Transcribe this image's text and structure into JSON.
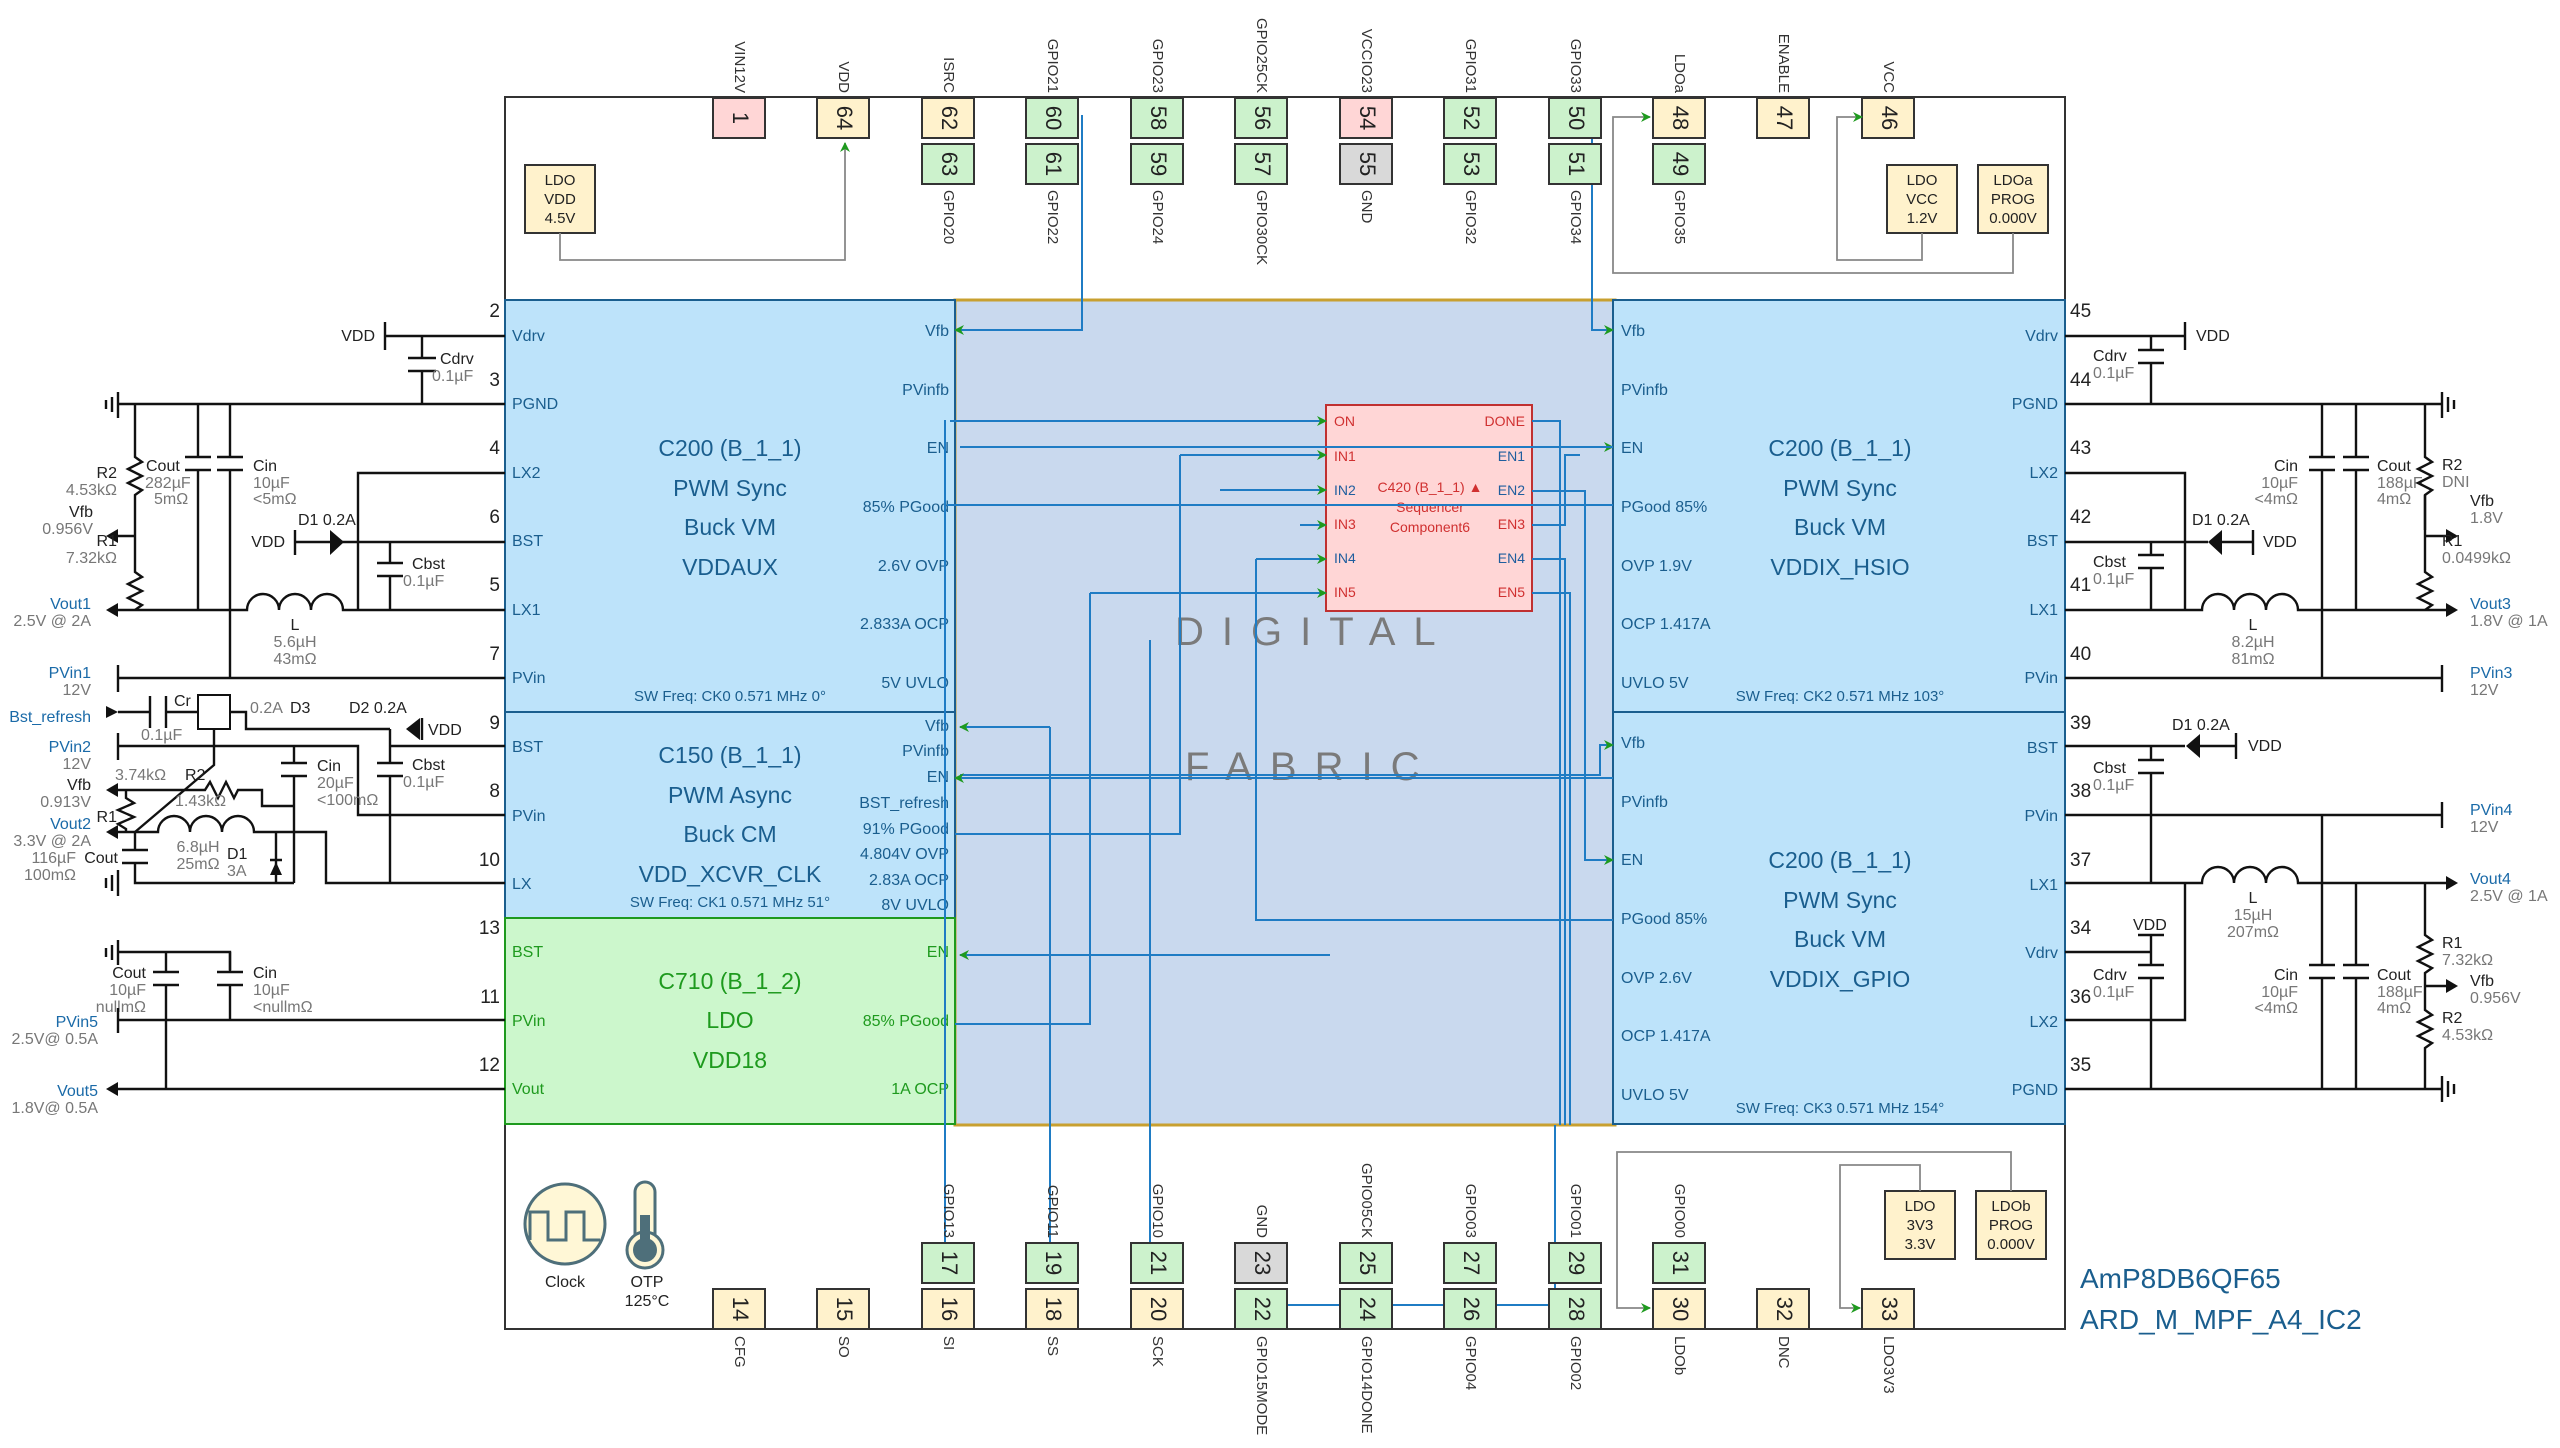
{
  "title": {
    "part": "AmP8DB6QF65",
    "design": "ARD_M_MPF_A4_IC2"
  },
  "colors": {
    "buck_fill": "#bde3fa",
    "ldo_fill": "#ccf7cc",
    "fabric_fill": "#c9d9ee",
    "sequencer_fill": "#ffd6d6",
    "pin_power": "#fff2cc",
    "pin_gpio": "#ccf2cc",
    "pin_red": "#ffd6d6",
    "pin_gnd": "#d9d9d9",
    "signal_wire": "#1f7cc4",
    "arrow": "#1e9a1e"
  },
  "top_pins": [
    {
      "num": "1",
      "label": "VIN12V",
      "type": "red"
    },
    {
      "num": "64",
      "label": "VDD",
      "type": "power"
    },
    {
      "num": "62",
      "label": "ISRC",
      "type": "power",
      "inner": {
        "num": "63",
        "label": "GPIO20"
      }
    },
    {
      "num": "60",
      "label": "GPIO21",
      "type": "gpio",
      "inner": {
        "num": "61",
        "label": "GPIO22"
      }
    },
    {
      "num": "58",
      "label": "GPIO23",
      "type": "gpio",
      "inner": {
        "num": "59",
        "label": "GPIO24"
      }
    },
    {
      "num": "56",
      "label": "GPIO25CK",
      "type": "gpio",
      "inner": {
        "num": "57",
        "label": "GPIO30CK"
      }
    },
    {
      "num": "54",
      "label": "VCCIO23",
      "type": "red",
      "inner": {
        "num": "55",
        "label": "GND",
        "type": "gnd"
      }
    },
    {
      "num": "52",
      "label": "GPIO31",
      "type": "gpio",
      "inner": {
        "num": "53",
        "label": "GPIO32"
      }
    },
    {
      "num": "50",
      "label": "GPIO33",
      "type": "gpio",
      "inner": {
        "num": "51",
        "label": "GPIO34"
      }
    },
    {
      "num": "48",
      "label": "LDOa",
      "type": "power",
      "inner": {
        "num": "49",
        "label": "GPIO35"
      }
    },
    {
      "num": "47",
      "label": "ENABLE",
      "type": "power"
    },
    {
      "num": "46",
      "label": "VCC",
      "type": "power"
    }
  ],
  "bottom_pins": [
    {
      "num": "14",
      "label": "CFG",
      "type": "power"
    },
    {
      "num": "15",
      "label": "SO",
      "type": "power"
    },
    {
      "num": "16",
      "label": "SI",
      "type": "power",
      "inner": {
        "num": "17",
        "label": "GPIO13"
      }
    },
    {
      "num": "18",
      "label": "SS",
      "type": "power",
      "inner": {
        "num": "19",
        "label": "GPIO11"
      }
    },
    {
      "num": "20",
      "label": "SCK",
      "type": "power",
      "inner": {
        "num": "21",
        "label": "GPIO10"
      }
    },
    {
      "num": "22",
      "label": "GPIO15MODE",
      "type": "gpio",
      "inner": {
        "num": "23",
        "label": "GND",
        "type": "gnd"
      }
    },
    {
      "num": "24",
      "label": "GPIO14DONE",
      "type": "gpio",
      "inner": {
        "num": "25",
        "label": "GPIO05CK"
      }
    },
    {
      "num": "26",
      "label": "GPIO04",
      "type": "gpio",
      "inner": {
        "num": "27",
        "label": "GPIO03"
      }
    },
    {
      "num": "28",
      "label": "GPIO02",
      "type": "gpio",
      "inner": {
        "num": "29",
        "label": "GPIO01"
      }
    },
    {
      "num": "30",
      "label": "LDOb",
      "type": "power",
      "inner": {
        "num": "31",
        "label": "GPIO00"
      }
    },
    {
      "num": "32",
      "label": "DNC",
      "type": "power"
    },
    {
      "num": "33",
      "label": "LDO3V3",
      "type": "power"
    }
  ],
  "ldo_boxes": {
    "vdd": [
      "LDO",
      "VDD",
      "4.5V"
    ],
    "vcc": [
      "LDO",
      "VCC",
      "1.2V"
    ],
    "ldoa": [
      "LDOa",
      "PROG",
      "0.000V"
    ],
    "v3v3": [
      "LDO",
      "3V3",
      "3.3V"
    ],
    "ldob": [
      "LDOb",
      "PROG",
      "0.000V"
    ]
  },
  "misc": {
    "clock_label": "Clock",
    "otp_label": "OTP",
    "otp_value": "125°C",
    "fabric_line1": "DIGITAL",
    "fabric_line2": "FABRIC"
  },
  "blocks": {
    "vddaux": {
      "title": [
        "C200 (B_1_1)",
        "PWM Sync",
        "Buck VM",
        "VDDAUX"
      ],
      "left_pins": [
        "Vdrv",
        "PGND",
        "LX2",
        "BST",
        "LX1",
        "PVin"
      ],
      "right_pins": [
        "Vfb",
        "PVinfb",
        "EN",
        "85% PGood",
        "2.6V OVP",
        "2.833A OCP",
        "5V UVLO"
      ],
      "sw": "SW Freq: CK0 0.571 MHz 0°",
      "ext_pins": [
        "2",
        "3",
        "4",
        "6",
        "5",
        "7"
      ]
    },
    "xcvr": {
      "title": [
        "C150 (B_1_1)",
        "PWM Async",
        "Buck CM",
        "VDD_XCVR_CLK"
      ],
      "left_pins": [
        "BST",
        "PVin",
        "LX"
      ],
      "right_pins": [
        "Vfb",
        "PVinfb",
        "EN",
        "BST_refresh",
        "91% PGood",
        "4.804V OVP",
        "2.83A OCP",
        "8V UVLO"
      ],
      "sw": "SW Freq: CK1 0.571 MHz 51°",
      "ext_pins": [
        "9",
        "8",
        "10"
      ]
    },
    "vdd18": {
      "title": [
        "C710 (B_1_2)",
        "LDO",
        "VDD18"
      ],
      "left_pins": [
        "BST",
        "PVin",
        "Vout"
      ],
      "right_pins": [
        "EN",
        "85% PGood",
        "1A OCP"
      ],
      "ext_pins": [
        "13",
        "11",
        "12"
      ]
    },
    "hsio": {
      "title": [
        "C200 (B_1_1)",
        "PWM Sync",
        "Buck VM",
        "VDDIX_HSIO"
      ],
      "left_pins": [
        "Vfb",
        "PVinfb",
        "EN",
        "PGood 85%",
        "OVP 1.9V",
        "OCP 1.417A",
        "UVLO 5V"
      ],
      "right_pins": [
        "Vdrv",
        "PGND",
        "LX2",
        "BST",
        "LX1",
        "PVin"
      ],
      "sw": "SW Freq: CK2 0.571 MHz 103°",
      "ext_pins": [
        "45",
        "44",
        "43",
        "42",
        "41",
        "40"
      ]
    },
    "gpio": {
      "title": [
        "C200 (B_1_1)",
        "PWM Sync",
        "Buck VM",
        "VDDIX_GPIO"
      ],
      "left_pins": [
        "Vfb",
        "PVinfb",
        "EN",
        "PGood 85%",
        "OVP 2.6V",
        "OCP 1.417A",
        "UVLO 5V"
      ],
      "right_pins": [
        "BST",
        "PVin",
        "LX1",
        "Vdrv",
        "LX2",
        "PGND"
      ],
      "sw": "SW Freq: CK3 0.571 MHz 154°",
      "ext_pins": [
        "39",
        "38",
        "37",
        "34",
        "36",
        "35"
      ]
    }
  },
  "sequencer": {
    "title": "C420 (B_1_1) ▲",
    "line2": "Sequencer",
    "line3": "Component6",
    "inputs": [
      "ON",
      "IN1",
      "IN2",
      "IN3",
      "IN4",
      "IN5"
    ],
    "outputs": [
      "DONE",
      "EN1",
      "EN2",
      "EN3",
      "EN4",
      "EN5"
    ]
  },
  "left_circuit": {
    "vdd": "VDD",
    "cdrv": [
      "Cdrv",
      "0.1µF"
    ],
    "r2": [
      "R2",
      "4.53kΩ"
    ],
    "cout": [
      "Cout",
      "282µF",
      "5mΩ"
    ],
    "cin": [
      "Cin",
      "10µF",
      "<5mΩ"
    ],
    "vfb": [
      "Vfb",
      "0.956V"
    ],
    "r1": [
      "R1",
      "7.32kΩ"
    ],
    "d1": "D1 0.2A",
    "cbst": [
      "Cbst",
      "0.1µF"
    ],
    "vout1": [
      "Vout1",
      "2.5V @ 2A"
    ],
    "l": [
      "L",
      "5.6µH",
      "43mΩ"
    ],
    "pvin1": [
      "PVin1",
      "12V"
    ],
    "bst_refresh": "Bst_refresh",
    "cr": [
      "Cr",
      "0.1µF"
    ],
    "d3": [
      "0.2A",
      "D3"
    ],
    "d2": "D2 0.2A",
    "pvin2": [
      "PVin2",
      "12V"
    ],
    "r2b": [
      "R2",
      "3.74kΩ"
    ],
    "r1b_val": "1.43kΩ",
    "vfb2": [
      "Vfb",
      "0.913V"
    ],
    "r1b": "R1",
    "cin2": [
      "Cin",
      "20µF",
      "<100mΩ"
    ],
    "cbst2": [
      "Cbst",
      "0.1µF"
    ],
    "vout2": [
      "Vout2",
      "3.3V @ 2A"
    ],
    "l2": [
      "6.8µH",
      "25mΩ"
    ],
    "d1b": [
      "D1",
      "3A"
    ],
    "cout2": [
      "116µF",
      "Cout",
      "100mΩ"
    ],
    "cout5": [
      "Cout",
      "10µF",
      "nullmΩ"
    ],
    "cin5": [
      "Cin",
      "10µF",
      "<nullmΩ"
    ],
    "pvin5": [
      "PVin5",
      "2.5V@ 0.5A"
    ],
    "vout5": [
      "Vout5",
      "1.8V@ 0.5A"
    ]
  },
  "right_circuit": {
    "vdd": "VDD",
    "cdrv": [
      "Cdrv",
      "0.1µF"
    ],
    "cin": [
      "Cin",
      "10µF",
      "<4mΩ"
    ],
    "cout": [
      "Cout",
      "188µF",
      "4mΩ"
    ],
    "r2": [
      "R2",
      "DNI"
    ],
    "vfb": [
      "Vfb",
      "1.8V"
    ],
    "d1": "D1 0.2A",
    "r1": [
      "R1",
      "0.0499kΩ"
    ],
    "cbst": [
      "Cbst",
      "0.1µF"
    ],
    "vout3": [
      "Vout3",
      "1.8V @ 1A"
    ],
    "l": [
      "L",
      "8.2µH",
      "81mΩ"
    ],
    "pvin3": [
      "PVin3",
      "12V"
    ],
    "d1b": "D1 0.2A",
    "cbst2": [
      "Cbst",
      "0.1µF"
    ],
    "pvin4": [
      "PVin4",
      "12V"
    ],
    "vout4": [
      "Vout4",
      "2.5V @ 1A"
    ],
    "l2": [
      "L",
      "15µH",
      "207mΩ"
    ],
    "vdd2": "VDD",
    "r1b": [
      "R1",
      "7.32kΩ"
    ],
    "cdrv2": [
      "Cdrv",
      "0.1µF"
    ],
    "cin2": [
      "Cin",
      "10µF",
      "<4mΩ"
    ],
    "cout2": [
      "Cout",
      "188µF",
      "4mΩ"
    ],
    "vfb2": [
      "Vfb",
      "0.956V"
    ],
    "r2b": [
      "R2",
      "4.53kΩ"
    ]
  }
}
